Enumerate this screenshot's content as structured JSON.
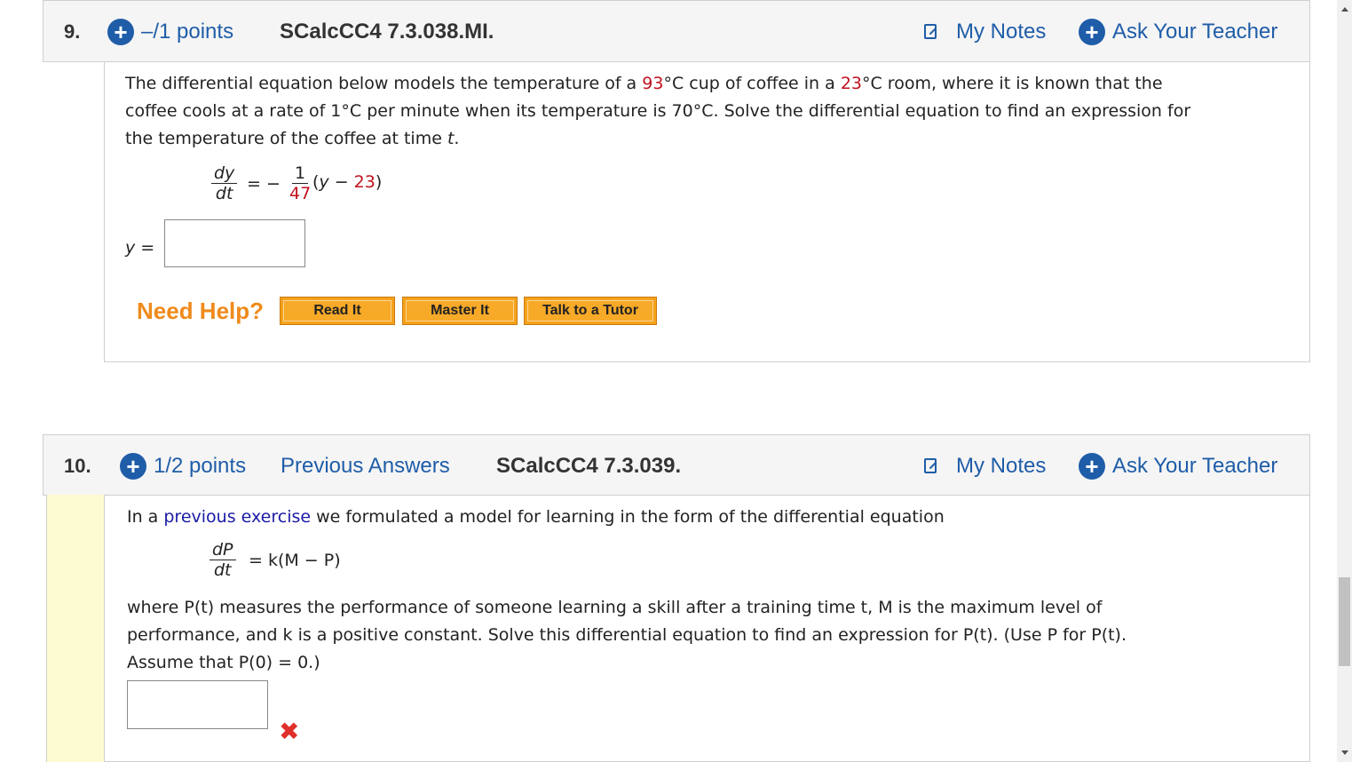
{
  "q9": {
    "number": "9.",
    "points": "–/1 points",
    "code": "SCalcCC4 7.3.038.MI.",
    "my_notes": "My Notes",
    "ask_teacher": "Ask Your Teacher",
    "text_line1_a": "The differential equation below models the temperature of a ",
    "temp_coffee": "93",
    "text_line1_b": "°C cup of coffee in a ",
    "temp_room": "23",
    "text_line1_c": "°C room, where it is known that the",
    "text_line2": "coffee cools at a rate of 1°C per minute when its temperature is 70°C. Solve the differential equation to find an expression for",
    "text_line3_a": "the temperature of the coffee at time ",
    "text_line3_var": "t",
    "text_line3_b": ".",
    "eq_lhs_num": "dy",
    "eq_lhs_den": "dt",
    "eq_equals": "= −",
    "eq_rhs_num": "1",
    "eq_rhs_den": "47",
    "eq_rhs_paren_open": "(",
    "eq_rhs_var": "y",
    "eq_rhs_minus": " − ",
    "eq_rhs_const": "23",
    "eq_rhs_paren_close": ")",
    "answer_label_var": "y",
    "answer_label_eq": " =",
    "need_help": "Need Help?",
    "btn_read": "Read It",
    "btn_master": "Master It",
    "btn_tutor": "Talk to a Tutor"
  },
  "q10": {
    "number": "10.",
    "points": "1/2 points",
    "previous_answers": "Previous Answers",
    "code": "SCalcCC4 7.3.039.",
    "my_notes": "My Notes",
    "ask_teacher": "Ask Your Teacher",
    "intro_a": "In a ",
    "intro_link": "previous exercise",
    "intro_b": " we formulated a model for learning in the form of the differential equation",
    "eq_lhs_num": "dP",
    "eq_lhs_den": "dt",
    "eq_rhs": "= k(M − P)",
    "line1": "where P(t) measures the performance of someone learning a skill after a training time t, M is the maximum level of",
    "line2": "performance, and k is a positive constant. Solve this differential equation to find an expression for  P(t).  (Use P for P(t).",
    "line3": "Assume that P(0) = 0.)",
    "incorrect_mark": "✖"
  },
  "icons": {
    "plus": "+",
    "note": "note-icon"
  },
  "colors": {
    "accent": "#1f5da8",
    "red": "#c0121f",
    "help_orange": "#f08a1c",
    "button": "#f5a21a"
  }
}
